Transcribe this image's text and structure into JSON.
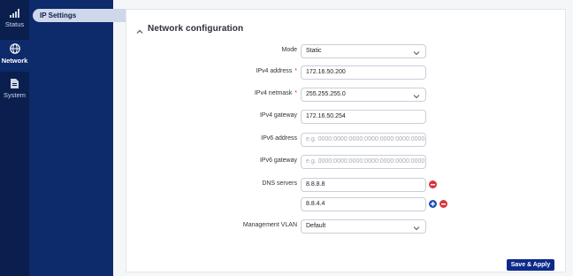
{
  "rail": {
    "items": [
      {
        "label": "Status",
        "icon": "signal-bars-icon"
      },
      {
        "label": "Network",
        "icon": "globe-icon"
      },
      {
        "label": "System",
        "icon": "document-icon"
      }
    ]
  },
  "subnav": {
    "items": [
      {
        "label": "IP Settings"
      }
    ]
  },
  "section": {
    "title": "Network configuration"
  },
  "form": {
    "mode": {
      "label": "Mode",
      "value": "Static"
    },
    "ipv4_address": {
      "label": "IPv4 address",
      "required": "*",
      "value": "172.16.50.200"
    },
    "ipv4_netmask": {
      "label": "IPv4 netmask",
      "required": "*",
      "value": "255.255.255.0"
    },
    "ipv4_gateway": {
      "label": "IPv4 gateway",
      "value": "172.16.50.254"
    },
    "ipv6_address": {
      "label": "IPv6 address",
      "placeholder": "e.g. 0000:0000:0000:0000:0000:0000:0000:0000"
    },
    "ipv6_gateway": {
      "label": "IPv6 gateway",
      "placeholder": "e.g. 0000:0000:0000:0000:0000:0000:0000:0000"
    },
    "dns": {
      "label": "DNS servers",
      "values": [
        "8.8.8.8",
        "8.8.4.4"
      ]
    },
    "mgmt_vlan": {
      "label": "Management VLAN",
      "value": "Default"
    }
  },
  "actions": {
    "save_label": "Save & Apply"
  },
  "colors": {
    "rail_bg": "#0a1f4d",
    "subnav_bg": "#0d2a6b",
    "accent": "#0d2a8a",
    "remove": "#d9363e",
    "add": "#1c4fb8"
  }
}
